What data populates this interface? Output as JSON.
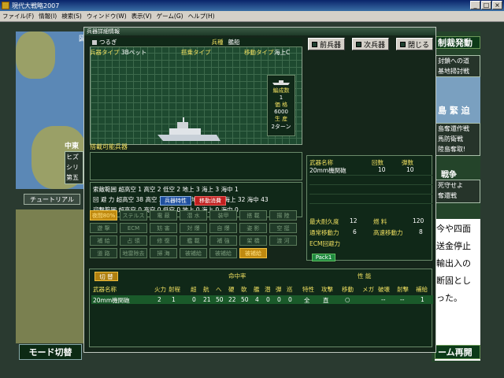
{
  "window": {
    "title": "現代大戦略2007",
    "controls": [
      "_",
      "□",
      "×"
    ]
  },
  "menubar": {
    "items": [
      "ファイル(F)",
      "情報(I)",
      "検索(S)",
      "ウィンドウ(W)",
      "表示(V)",
      "ゲーム(G)",
      "ヘルプ(H)"
    ]
  },
  "background": {
    "left_labels": [
      "中東",
      "ヒズ",
      "シリ",
      "第五"
    ],
    "left_top_label": "図",
    "tutorial_btn": "チュートリアル",
    "mode_btn": "モード切替",
    "right_btn_top": "制裁発動",
    "right_items": [
      "封鎖への道",
      "基地掃討戦"
    ],
    "right_island": "島 緊 迫",
    "right_ops": [
      "島奪還作戦",
      "馬防衛戦",
      "陸島奪取!"
    ],
    "right_war": "戦争",
    "right_war_items": [
      "死守せよ",
      "奪還戦"
    ],
    "right_text": [
      "今や四面",
      "送金停止",
      "輸出入の",
      "断固とし",
      "った。"
    ],
    "resume_btn": "ーム再開"
  },
  "panel": {
    "title": "兵器詳細情報",
    "unit_name": "つるぎ",
    "kind_label": "兵種",
    "kind_value": "艦船",
    "type_label": "兵器タイプ",
    "type_value": "3Bペット",
    "carry_label": "搭乗タイプ",
    "move_label": "移動タイプ",
    "move_value": "海上C",
    "buttons": {
      "prev": "前兵器",
      "next": "次兵器",
      "close": "閉じる"
    },
    "info": {
      "count_label": "編成数",
      "count_value": "1",
      "price_label": "価 格",
      "price_value": "6000",
      "prod_label": "生 産",
      "prod_value": "2ターン"
    },
    "loadable_label": "搭載可能兵器",
    "stats": {
      "rows": [
        "索敵範囲 超高空 1 高空 2 低空 2 地上 3 海上 3 海中 1",
        "回 避 力 超高空 38 高空 38 低空 34 地上 20:20 海上 32 海中 43",
        "迎撃範囲 超高空 0 高空 0 低空 0 地上 0 海上 0 海中 0"
      ]
    },
    "tags": {
      "feature": "兵器特性",
      "consume": "移動消費"
    },
    "options": [
      "夜間80%",
      "ステルス",
      "電 蔽",
      "潜 水",
      "装甲",
      "搭 載",
      "揚 陸",
      "遊 撃",
      "ECM",
      "妨 害",
      "対 爆",
      "自 爆",
      "姿 影",
      "空 挺",
      "補 給",
      "占 領",
      "修 復",
      "艦 載",
      "補 強",
      "架 橋",
      "渡 河",
      "道 路",
      "地雷除去",
      "掃 海",
      "被補給",
      "被補給",
      "被補給"
    ],
    "weapon_info": {
      "headers": [
        "武器名称",
        "回数",
        "弾数"
      ],
      "weapon_name": "20mm機関砲",
      "count": "10",
      "ammo": "10",
      "endurance_label": "最大耐久度",
      "endurance": "12",
      "fuel_label": "燃 料",
      "fuel": "120",
      "normal_move_label": "通常移動力",
      "normal_move": "6",
      "fast_move_label": "高速移動力",
      "fast_move": "8",
      "ecm_label": "ECM回避力",
      "pack": "Pack1"
    },
    "table": {
      "switch_btn": "切 替",
      "acc_label": "命中率",
      "perf_label": "性 能",
      "headers": [
        "武器名称",
        "火力",
        "射程",
        "超",
        "航",
        "へ",
        "硬",
        "軟",
        "艦",
        "潜",
        "弾",
        "巡",
        "特性",
        "攻撃",
        "移動",
        "メガ",
        "破壊",
        "射撃",
        "補給"
      ],
      "row": [
        "20mm機関砲",
        "2",
        "1",
        "0",
        "21",
        "50",
        "22",
        "50",
        "4",
        "0",
        "0",
        "0",
        "全",
        "直",
        "",
        "○",
        "--",
        "--",
        "1"
      ]
    }
  }
}
